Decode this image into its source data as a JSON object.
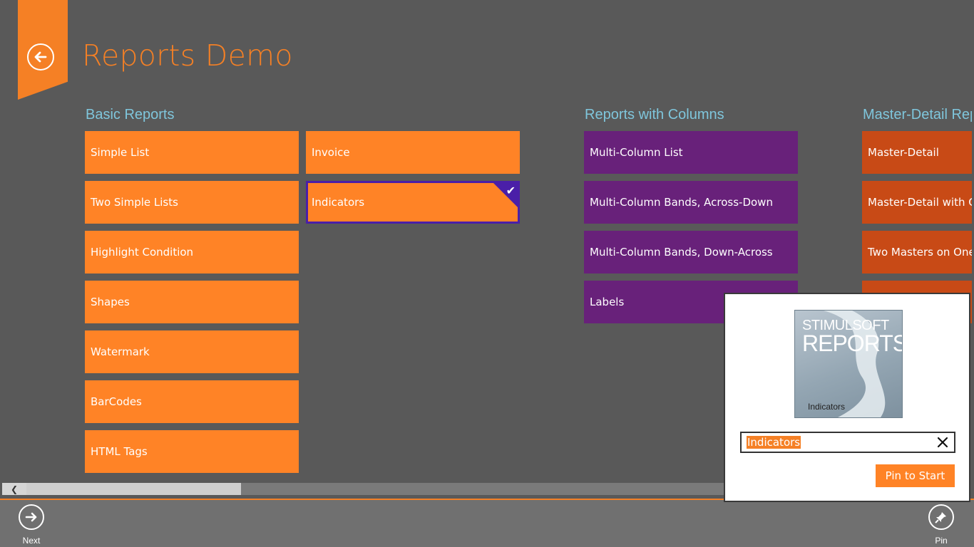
{
  "header": {
    "title": "Reports Demo",
    "back_icon": "back-arrow-icon"
  },
  "groups": {
    "basic": {
      "title": "Basic Reports",
      "col1": [
        "Simple List",
        "Two Simple Lists",
        "Highlight Condition",
        "Shapes",
        "Watermark",
        "BarCodes",
        "HTML Tags"
      ],
      "col2": [
        "Invoice",
        "Indicators"
      ],
      "selected": "Indicators"
    },
    "columns": {
      "title": "Reports with Columns",
      "items": [
        "Multi-Column List",
        "Multi-Column Bands, Across-Down",
        "Multi-Column Bands, Down-Across",
        "Labels"
      ]
    },
    "masterdetail": {
      "title": "Master-Detail Rep",
      "items": [
        "Master-Detail",
        "Master-Detail with Col",
        "Two Masters on One D",
        ""
      ]
    }
  },
  "colors": {
    "accent": "#F58025",
    "tile_orange": "#FF8326",
    "tile_purple": "#68217A",
    "tile_rust": "#C84A16",
    "group_title": "#7fc6dc"
  },
  "flyout": {
    "preview_brand_line1": "STIMULSOFT",
    "preview_brand_line2": "REPORTS",
    "preview_name": "Indicators",
    "name_value": "Indicators",
    "pin_button_label": "Pin to Start"
  },
  "appbar": {
    "next_label": "Next",
    "pin_label": "Pin"
  }
}
